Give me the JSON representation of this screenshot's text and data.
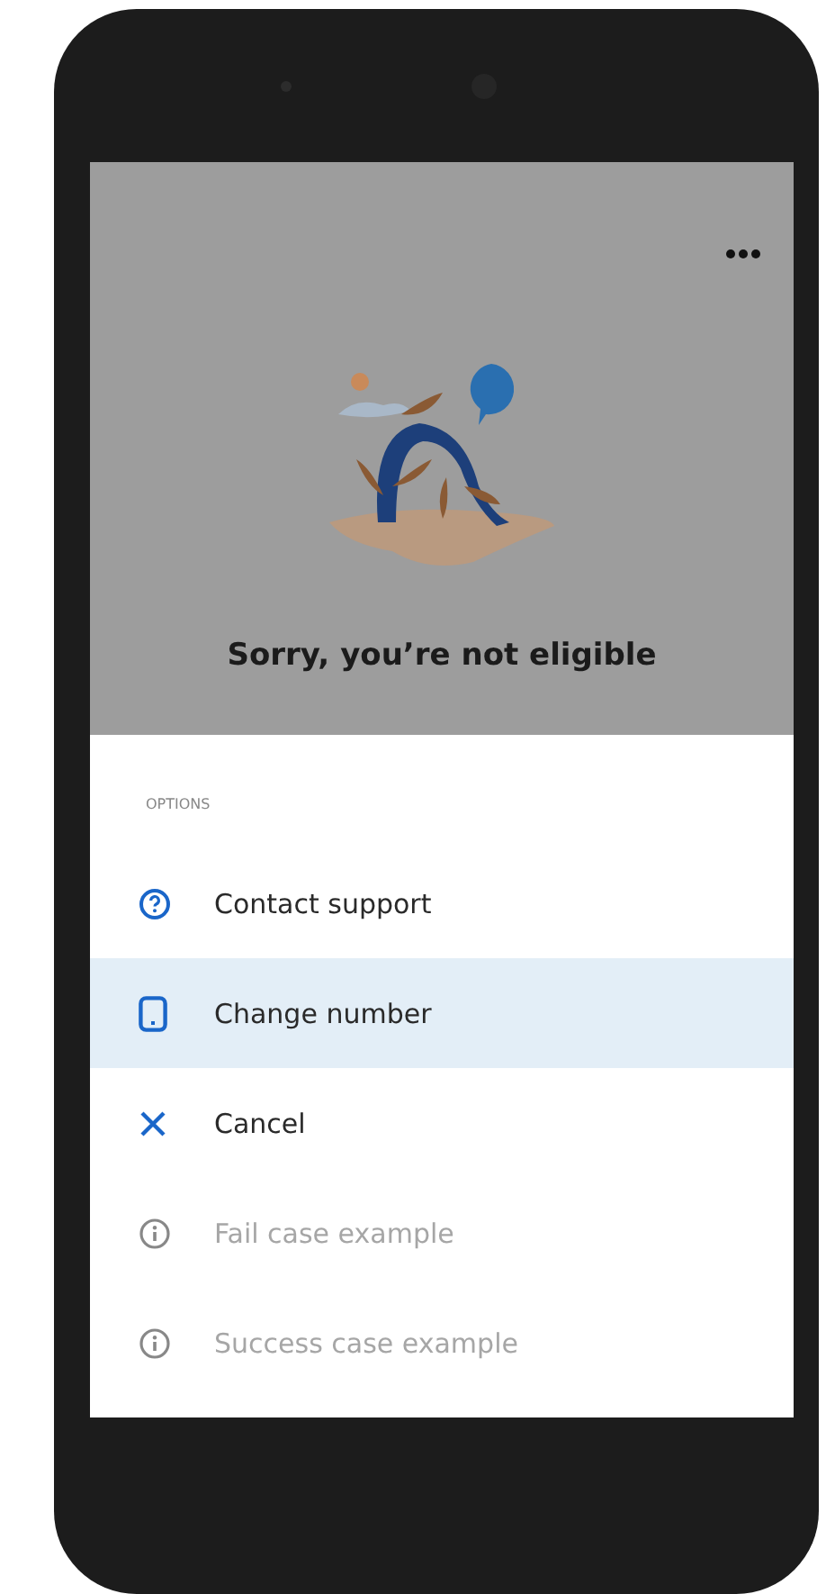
{
  "screen": {
    "heading": "Sorry, you’re not eligible"
  },
  "sheet": {
    "section_label": "OPTIONS",
    "items": [
      {
        "label": "Contact support",
        "kind": "help",
        "selected": false,
        "disabled": false
      },
      {
        "label": "Change number",
        "kind": "phone",
        "selected": true,
        "disabled": false
      },
      {
        "label": "Cancel",
        "kind": "close",
        "selected": false,
        "disabled": false
      },
      {
        "label": "Fail case example",
        "kind": "info",
        "selected": false,
        "disabled": true
      },
      {
        "label": "Success case example",
        "kind": "info",
        "selected": false,
        "disabled": true
      }
    ]
  }
}
